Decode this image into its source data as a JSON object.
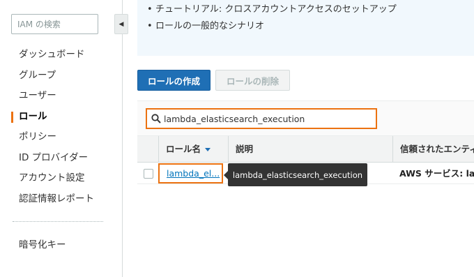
{
  "sidebar": {
    "search_placeholder": "IAM の検索",
    "collapse_glyph": "◀",
    "items": [
      {
        "label": "ダッシュボード"
      },
      {
        "label": "グループ"
      },
      {
        "label": "ユーザー"
      },
      {
        "label": "ロール",
        "active": true
      },
      {
        "label": "ポリシー"
      },
      {
        "label": "ID プロバイダー"
      },
      {
        "label": "アカウント設定"
      },
      {
        "label": "認証情報レポート"
      }
    ],
    "extra_items": [
      {
        "label": "暗号化キー"
      }
    ]
  },
  "info": {
    "links": [
      {
        "label": "チュートリアル: クロスアカウントアクセスのセットアップ"
      },
      {
        "label": "ロールの一般的なシナリオ"
      }
    ],
    "bullet": "•"
  },
  "toolbar": {
    "create_label": "ロールの作成",
    "delete_label": "ロールの削除"
  },
  "filter": {
    "value": "lambda_elasticsearch_execution",
    "icon": "search-icon"
  },
  "table": {
    "columns": [
      {
        "label": ""
      },
      {
        "label": "ロール名",
        "sorted": "desc"
      },
      {
        "label": "説明"
      },
      {
        "label": "信頼されたエンティティ"
      }
    ],
    "rows": [
      {
        "name": "lambda_el...",
        "description": "",
        "trusted": "AWS サービス: la"
      }
    ]
  },
  "tooltip": {
    "text": "lambda_elasticsearch_execution"
  },
  "colors": {
    "accent_orange": "#ec7211",
    "primary_blue": "#1f6fb5",
    "link_blue": "#0073bb",
    "info_bg": "#f1f8fd"
  }
}
